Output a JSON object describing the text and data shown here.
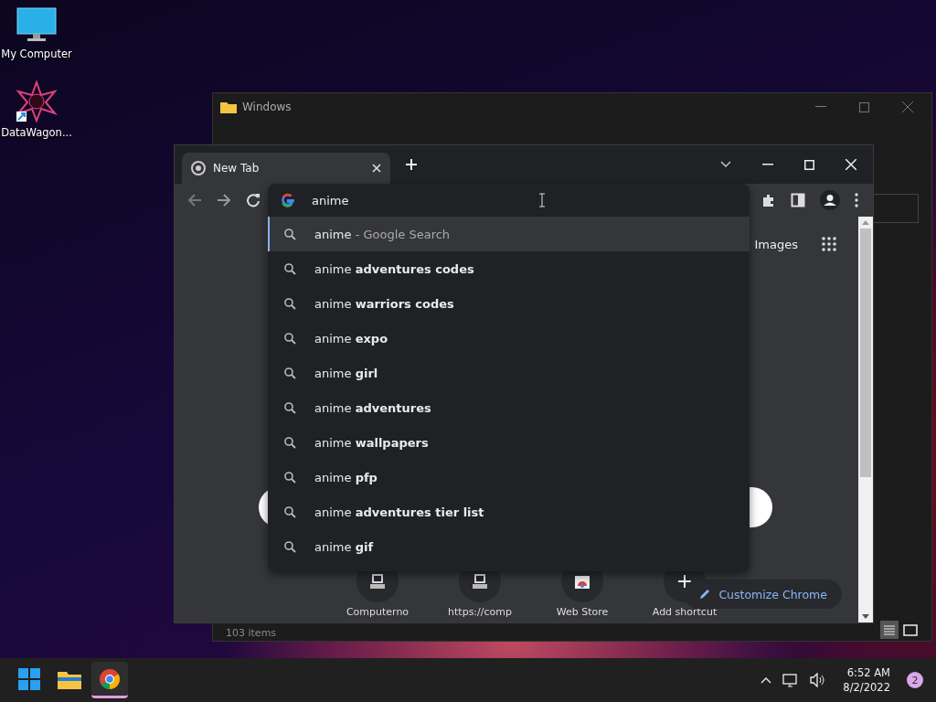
{
  "desktop_icons": [
    {
      "kind": "computer",
      "label": "My Computer"
    },
    {
      "kind": "star",
      "label": "DataWagon..."
    }
  ],
  "explorer": {
    "title": "Windows",
    "status": "103 items"
  },
  "browser": {
    "tabs": [
      {
        "label": "New Tab",
        "selected": true
      }
    ],
    "omnibox": {
      "value": "anime"
    },
    "suggestions": [
      {
        "query": "anime",
        "suffix": "- Google Search",
        "selected": true
      },
      {
        "query": "anime",
        "completion": "adventures codes",
        "selected": false
      },
      {
        "query": "anime",
        "completion": "warriors codes",
        "selected": false
      },
      {
        "query": "anime",
        "completion": "expo",
        "selected": false
      },
      {
        "query": "anime",
        "completion": "girl",
        "selected": false
      },
      {
        "query": "anime",
        "completion": "adventures",
        "selected": false
      },
      {
        "query": "anime",
        "completion": "wallpapers",
        "selected": false
      },
      {
        "query": "anime",
        "completion": "pfp",
        "selected": false
      },
      {
        "query": "anime",
        "completion": "adventures tier list",
        "selected": false
      },
      {
        "query": "anime",
        "completion": "gif",
        "selected": false
      }
    ],
    "images_link": "Images",
    "shortcuts": [
      {
        "kind": "computer",
        "label": "Computerno"
      },
      {
        "kind": "computer",
        "label": "https://comp"
      },
      {
        "kind": "store",
        "label": "Web Store"
      },
      {
        "kind": "add",
        "label": "Add shortcut"
      }
    ],
    "customize": "Customize Chrome"
  },
  "taskbar": {
    "apps": [
      {
        "kind": "start",
        "selected": false
      },
      {
        "kind": "folder",
        "selected": false
      },
      {
        "kind": "chrome",
        "selected": true
      }
    ],
    "time": "6:52 AM",
    "date": "8/2/2022",
    "notifications": "2"
  }
}
